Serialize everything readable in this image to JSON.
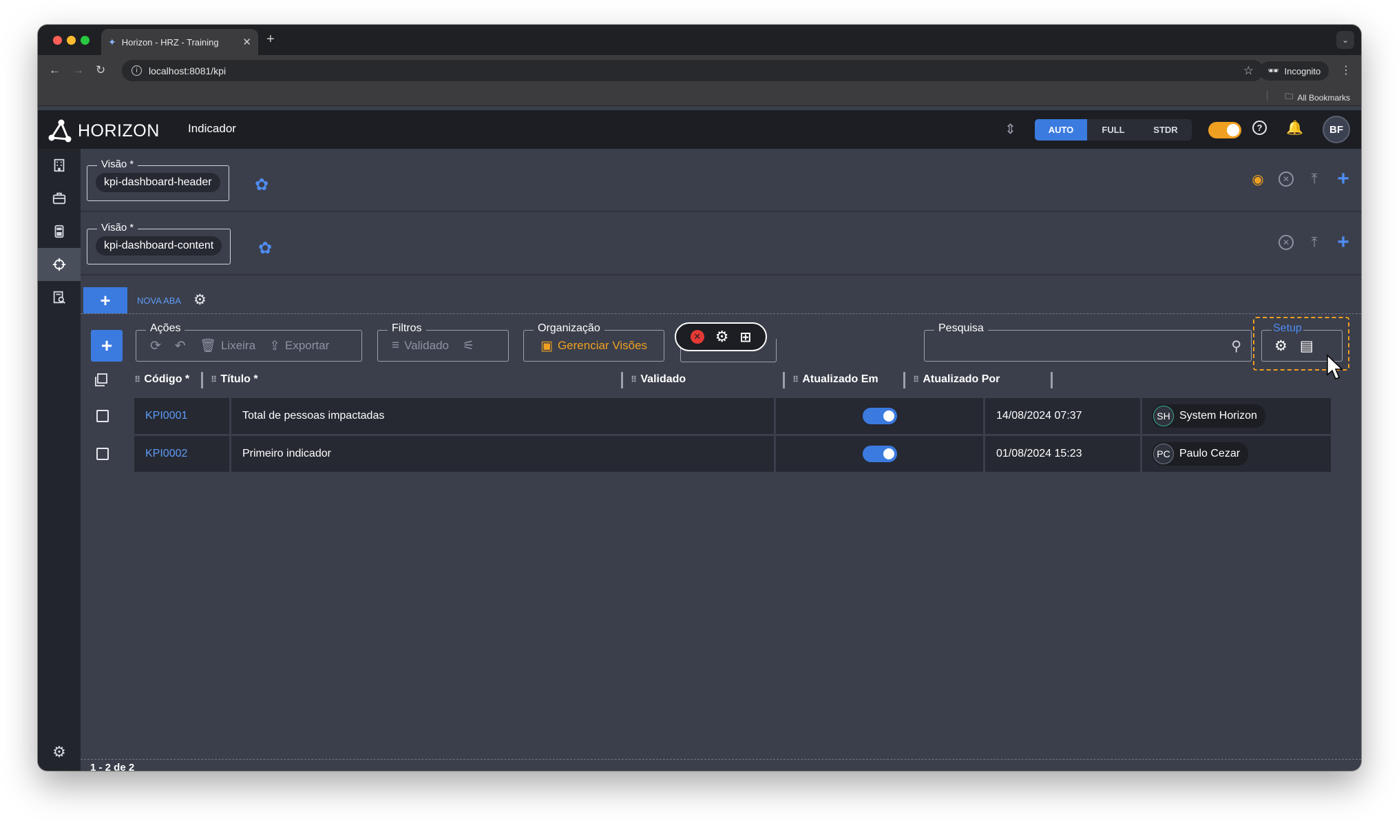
{
  "browser": {
    "tab_title": "Horizon - HRZ - Training",
    "url": "localhost:8081/kpi",
    "incognito_label": "Incognito",
    "bookmarks_label": "All Bookmarks"
  },
  "app": {
    "logo_text": "HORIZON",
    "page_title": "Indicador",
    "modes": [
      {
        "label": "AUTO",
        "active": true
      },
      {
        "label": "FULL",
        "active": false
      },
      {
        "label": "STDR",
        "active": false
      }
    ],
    "user_initials": "BF",
    "accent_color": "#3b7be0",
    "warning_color": "#f0a020"
  },
  "views": [
    {
      "legend": "Visão *",
      "value": "kpi-dashboard-header"
    },
    {
      "legend": "Visão *",
      "value": "kpi-dashboard-content"
    }
  ],
  "tabs": {
    "add_label": "+",
    "items": [
      {
        "label": "NOVA ABA"
      }
    ]
  },
  "toolbar": {
    "add_label": "+",
    "acoes": {
      "legend": "Ações",
      "lixeira": "Lixeira",
      "exportar": "Exportar"
    },
    "filtros": {
      "legend": "Filtros",
      "validado": "Validado"
    },
    "organizacao": {
      "legend": "Organização",
      "gerenciar": "Gerenciar Visões"
    },
    "pesquisa": {
      "legend": "Pesquisa",
      "value": ""
    },
    "setup": {
      "legend": "Setup"
    }
  },
  "table": {
    "columns": [
      "Código *",
      "Título *",
      "Validado",
      "Atualizado Em",
      "Atualizado Por"
    ],
    "rows": [
      {
        "code": "KPI0001",
        "title": "Total de pessoas impactadas",
        "validated": true,
        "updated_at": "14/08/2024 07:37",
        "user_initials": "SH",
        "user_name": "System Horizon"
      },
      {
        "code": "KPI0002",
        "title": "Primeiro indicador",
        "validated": true,
        "updated_at": "01/08/2024 15:23",
        "user_initials": "PC",
        "user_name": "Paulo Cezar"
      }
    ]
  },
  "pager": {
    "text": "1 - 2 de 2"
  }
}
